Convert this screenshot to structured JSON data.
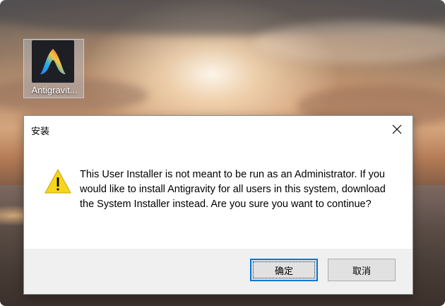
{
  "desktop": {
    "icons": [
      {
        "label": "Antigravit...",
        "icon": "antigravity-app-icon"
      }
    ]
  },
  "dialog": {
    "title": "安装",
    "close_icon": "close-icon",
    "warning_icon": "warning-icon",
    "message": "This User Installer is not meant to be run as an Administrator. If you would like to install Antigravity for all users in this system, download the System Installer instead. Are you sure you want to continue?",
    "buttons": {
      "ok_label": "确定",
      "cancel_label": "取消"
    }
  },
  "colors": {
    "focus_accent": "#0078d7",
    "warning_yellow": "#f7d51d",
    "footer_bg": "#f0f0f0"
  }
}
